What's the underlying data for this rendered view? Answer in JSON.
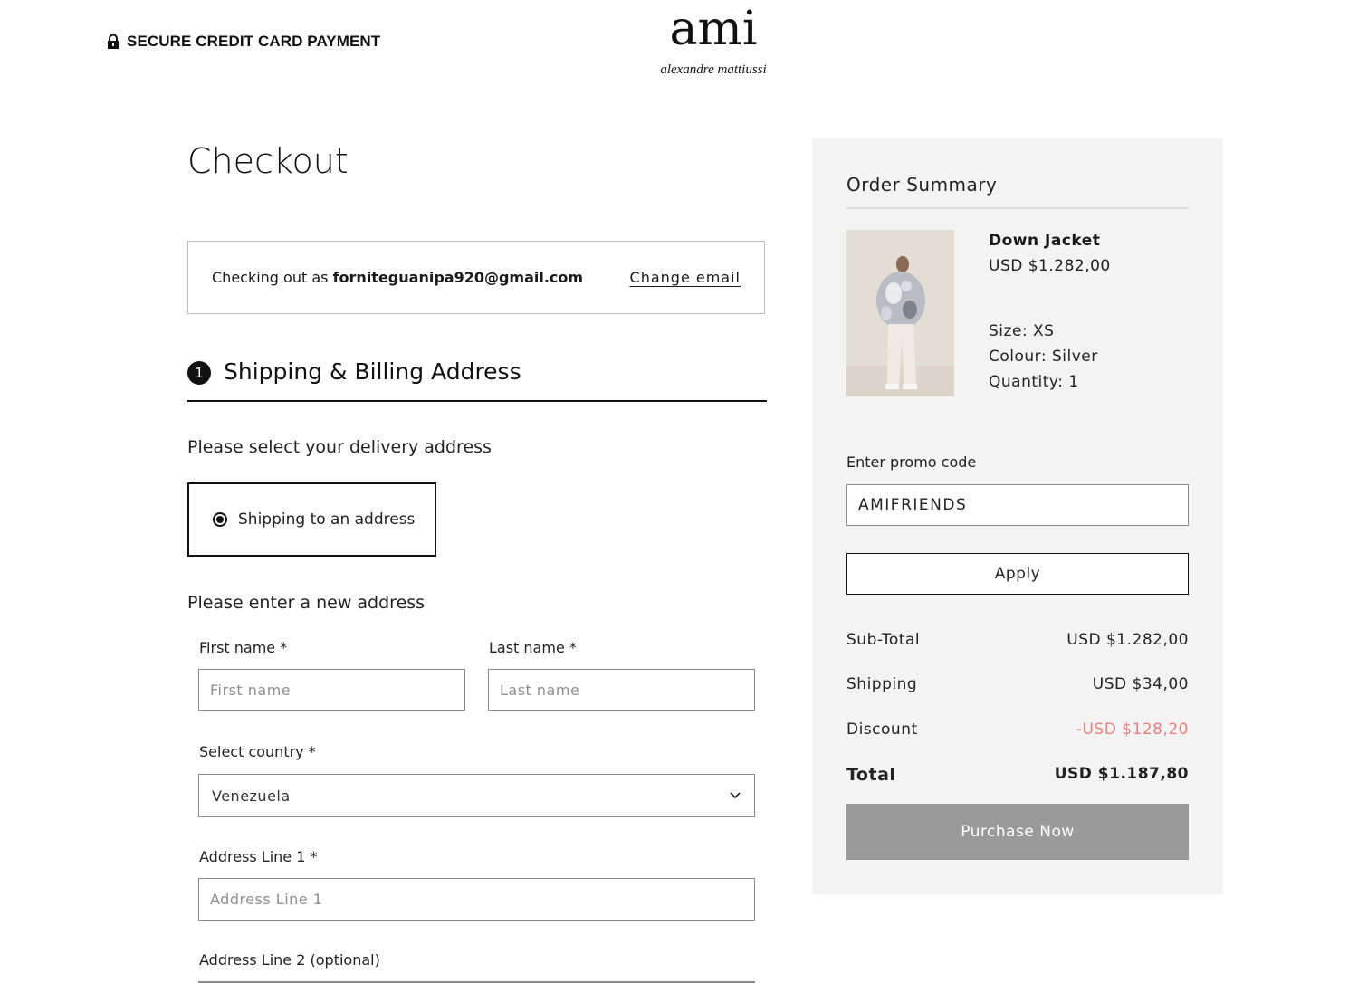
{
  "header": {
    "secure_label": "SECURE CREDIT CARD PAYMENT",
    "logo_main": "ami",
    "logo_sub": "alexandre mattiussi"
  },
  "checkout": {
    "title": "Checkout",
    "checking_out_as": "Checking out as",
    "email": "forniteguanipa920@gmail.com",
    "change_email": "Change email"
  },
  "step1": {
    "number": "1",
    "title": "Shipping & Billing Address"
  },
  "delivery": {
    "prompt": "Please select your delivery address",
    "option_label": "Shipping to an address",
    "selected": true
  },
  "new_address": {
    "prompt": "Please enter a new address",
    "first_name_label": "First name *",
    "first_name_placeholder": "First name",
    "last_name_label": "Last name *",
    "last_name_placeholder": "Last name",
    "country_label": "Select country *",
    "country_value": "Venezuela",
    "address1_label": "Address Line 1 *",
    "address1_placeholder": "Address Line 1",
    "address2_label": "Address Line 2 (optional)"
  },
  "summary": {
    "title": "Order Summary",
    "product": {
      "name": "Down Jacket",
      "price": "USD $1.282,00",
      "size": "Size: XS",
      "colour": "Colour: Silver",
      "quantity": "Quantity: 1"
    },
    "promo_label": "Enter promo code",
    "promo_value": "AMIFRIENDS",
    "apply_label": "Apply",
    "subtotal_label": "Sub-Total",
    "subtotal_value": "USD $1.282,00",
    "shipping_label": "Shipping",
    "shipping_value": "USD $34,00",
    "discount_label": "Discount",
    "discount_value": "-USD $128,20",
    "total_label": "Total",
    "total_value": "USD $1.187,80",
    "purchase_label": "Purchase Now"
  },
  "colors": {
    "discount": "#e8807f",
    "purchase_button": "#9a9a9a",
    "summary_bg": "#f3f3f3"
  }
}
